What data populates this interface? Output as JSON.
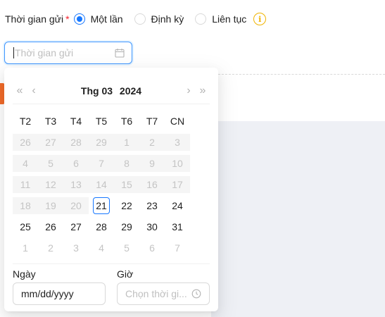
{
  "send": {
    "label": "Thời gian gửi",
    "required_mark": "*",
    "options": [
      {
        "label": "Một lần",
        "checked": true
      },
      {
        "label": "Định kỳ",
        "checked": false
      },
      {
        "label": "Liên tục",
        "checked": false
      }
    ],
    "info_icon": "info-icon"
  },
  "date_input": {
    "placeholder": "Thời gian gửi",
    "icon": "calendar-icon"
  },
  "picker": {
    "nav": {
      "prev_year": "«",
      "prev_month": "‹",
      "next_month": "›",
      "next_year": "»"
    },
    "month_label": "Thg 03",
    "year_label": "2024",
    "weekdays": [
      "T2",
      "T3",
      "T4",
      "T5",
      "T6",
      "T7",
      "CN"
    ],
    "weeks": [
      [
        {
          "d": "26",
          "s": "disabled"
        },
        {
          "d": "27",
          "s": "disabled"
        },
        {
          "d": "28",
          "s": "disabled"
        },
        {
          "d": "29",
          "s": "disabled"
        },
        {
          "d": "1",
          "s": "disabled"
        },
        {
          "d": "2",
          "s": "disabled"
        },
        {
          "d": "3",
          "s": "disabled"
        }
      ],
      [
        {
          "d": "4",
          "s": "disabled"
        },
        {
          "d": "5",
          "s": "disabled"
        },
        {
          "d": "6",
          "s": "disabled"
        },
        {
          "d": "7",
          "s": "disabled"
        },
        {
          "d": "8",
          "s": "disabled"
        },
        {
          "d": "9",
          "s": "disabled"
        },
        {
          "d": "10",
          "s": "disabled"
        }
      ],
      [
        {
          "d": "11",
          "s": "disabled"
        },
        {
          "d": "12",
          "s": "disabled"
        },
        {
          "d": "13",
          "s": "disabled"
        },
        {
          "d": "14",
          "s": "disabled"
        },
        {
          "d": "15",
          "s": "disabled"
        },
        {
          "d": "16",
          "s": "disabled"
        },
        {
          "d": "17",
          "s": "disabled"
        }
      ],
      [
        {
          "d": "18",
          "s": "disabled"
        },
        {
          "d": "19",
          "s": "disabled"
        },
        {
          "d": "20",
          "s": "disabled"
        },
        {
          "d": "21",
          "s": "today"
        },
        {
          "d": "22",
          "s": "normal"
        },
        {
          "d": "23",
          "s": "normal"
        },
        {
          "d": "24",
          "s": "normal"
        }
      ],
      [
        {
          "d": "25",
          "s": "normal"
        },
        {
          "d": "26",
          "s": "normal"
        },
        {
          "d": "27",
          "s": "normal"
        },
        {
          "d": "28",
          "s": "normal"
        },
        {
          "d": "29",
          "s": "normal"
        },
        {
          "d": "30",
          "s": "normal"
        },
        {
          "d": "31",
          "s": "normal"
        }
      ],
      [
        {
          "d": "1",
          "s": "other"
        },
        {
          "d": "2",
          "s": "other"
        },
        {
          "d": "3",
          "s": "other"
        },
        {
          "d": "4",
          "s": "other"
        },
        {
          "d": "5",
          "s": "other"
        },
        {
          "d": "6",
          "s": "other"
        },
        {
          "d": "7",
          "s": "other"
        }
      ]
    ],
    "footer": {
      "date_label": "Ngày",
      "date_value": "mm/dd/yyyy",
      "time_label": "Giờ",
      "time_placeholder": "Chọn thời gi...",
      "time_icon": "clock-icon"
    }
  },
  "colors": {
    "primary": "#1677ff",
    "warning": "#f0b400",
    "required": "#f5222d",
    "accent_tag": "#f26b2a"
  }
}
